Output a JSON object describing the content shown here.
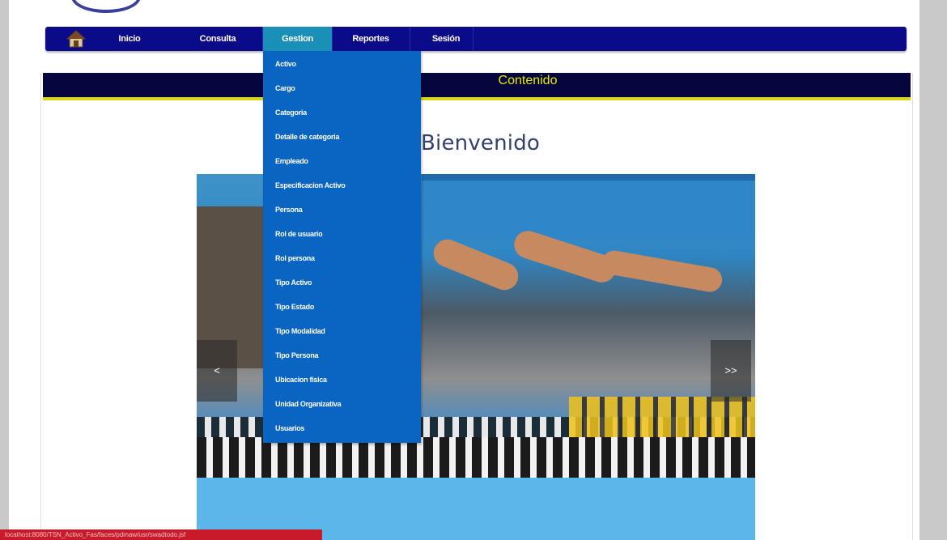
{
  "nav": {
    "home_icon": "house-icon",
    "items": [
      {
        "label": "Inicio"
      },
      {
        "label": "Consulta"
      },
      {
        "label": "Gestion"
      },
      {
        "label": "Reportes"
      },
      {
        "label": "Sesión"
      }
    ],
    "active_index": 2
  },
  "dropdown": {
    "items": [
      "Activo",
      "Cargo",
      "Categoria",
      "Detalle de categoria",
      "Empleado",
      "Especificacion Activo",
      "Persona",
      "Rol de usuario",
      "Rol persona",
      "Tipo Activo",
      "Tipo Estado",
      "Tipo Modalidad",
      "Tipo Persona",
      "Ubicacion fisica",
      "Unidad Organizativa",
      "Usuarios"
    ]
  },
  "content": {
    "bar_title": "Contenido",
    "welcome": "Bienvenido"
  },
  "slider": {
    "prev_label": "<",
    "next_label": ">>"
  },
  "status_bar": {
    "text": "localhost:8080/TSN_Activo_Fas/faces/pdmaw/usr/swadtodo.jsf"
  },
  "colors": {
    "nav_bg": "#0b0b8a",
    "nav_active": "#1a8fb8",
    "dropdown_bg": "#0a64c2",
    "content_bar": "#06063e",
    "content_title": "#e8e800",
    "status_bar": "#c91a2c"
  }
}
